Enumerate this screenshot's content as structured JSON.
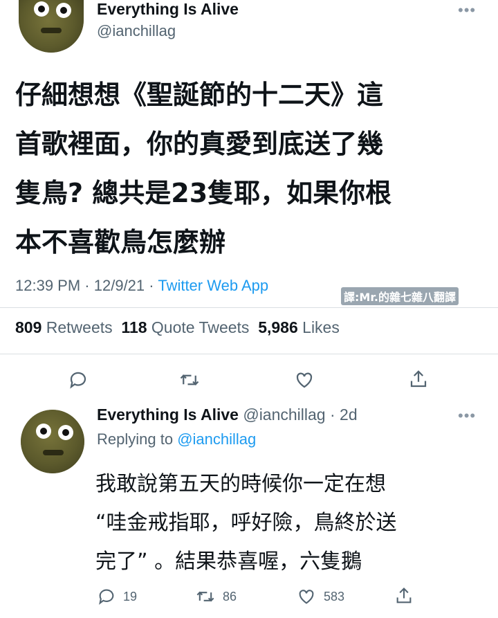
{
  "tweet": {
    "author_name": "Everything Is Alive",
    "author_handle": "@ianchillag",
    "more_icon": "•••",
    "text_lines": [
      "仔細想想《聖誕節的十二天》這",
      "首歌裡面，你的真愛到底送了幾",
      "隻鳥? 總共是23隻耶，如果你根",
      "本不喜歡鳥怎麼辦"
    ],
    "time": "12:39 PM",
    "date": "12/9/21",
    "sep": "·",
    "source": "Twitter Web App",
    "watermark": "譯:Mr.的雜七雜八翻譯",
    "retweets_count": "809",
    "retweets_label": "Retweets",
    "quotes_count": "118",
    "quotes_label": "Quote Tweets",
    "likes_count": "5,986",
    "likes_label": "Likes"
  },
  "reply": {
    "author_name": "Everything Is Alive",
    "author_handle": "@ianchillag",
    "age": "· 2d",
    "more_icon": "•••",
    "replying_prefix": "Replying to",
    "replying_handle": "@ianchillag",
    "text_lines": [
      "我敢說第五天的時候你一定在想",
      "“哇金戒指耶，呼好險，鳥終於送",
      "完了” 。結果恭喜喔，六隻鵝"
    ],
    "replies_count": "19",
    "retweets_count": "86",
    "likes_count": "583"
  },
  "icons": [
    "reply-icon",
    "retweet-icon",
    "like-icon",
    "share-icon"
  ],
  "colors": {
    "accent": "#1d9bf0",
    "secondary_text": "#536471",
    "primary_text": "#0f1419"
  }
}
